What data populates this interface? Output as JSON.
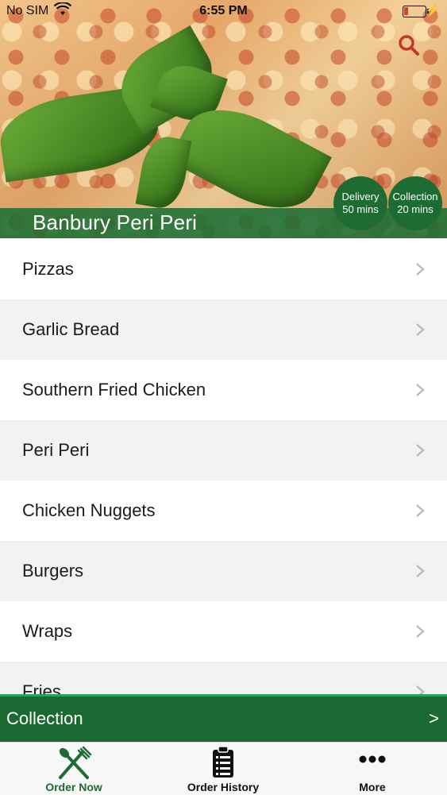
{
  "status_bar": {
    "carrier": "No SIM",
    "time": "6:55 PM"
  },
  "header": {
    "restaurant_name": "Banbury Peri Peri"
  },
  "badges": {
    "delivery": {
      "label": "Delivery",
      "time": "50 mins"
    },
    "collection": {
      "label": "Collection",
      "time": "20 mins"
    }
  },
  "menu": {
    "items": [
      {
        "label": "Pizzas"
      },
      {
        "label": "Garlic Bread"
      },
      {
        "label": "Southern Fried Chicken"
      },
      {
        "label": "Peri Peri"
      },
      {
        "label": "Chicken Nuggets"
      },
      {
        "label": "Burgers"
      },
      {
        "label": "Wraps"
      },
      {
        "label": "Fries"
      }
    ]
  },
  "order_mode": {
    "label": "Collection",
    "arrow": ">"
  },
  "tabbar": {
    "tabs": [
      {
        "label": "Order Now",
        "icon": "fork-knife-icon",
        "active": true
      },
      {
        "label": "Order History",
        "icon": "clipboard-list-icon",
        "active": false
      },
      {
        "label": "More",
        "icon": "more-dots-icon",
        "active": false
      }
    ]
  },
  "colors": {
    "brand_green": "#1f6b34",
    "accent_green": "#2aa35a",
    "search_red": "#c0392b"
  }
}
